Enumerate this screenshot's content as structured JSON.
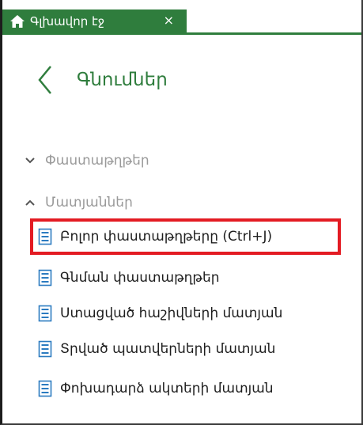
{
  "tab": {
    "title": "Գլխավոր էջ",
    "close_label": "×",
    "icon": "home-icon"
  },
  "header": {
    "title": "Գնումներ",
    "back_icon": "chevron-left-icon"
  },
  "sections": [
    {
      "label": "Փաստաթղթեր",
      "state": "collapsed",
      "icon": "chevron-down-icon"
    },
    {
      "label": "Մատյաններ",
      "state": "expanded",
      "icon": "chevron-up-icon"
    }
  ],
  "items": [
    {
      "label": "Բոլոր փաստաթղթերը (Ctrl+J)",
      "icon": "document-list-icon",
      "highlighted": true
    },
    {
      "label": "Գնման փաստաթղթեր",
      "icon": "document-list-icon"
    },
    {
      "label": "Ստացված հաշիվների մատյան",
      "icon": "document-list-icon"
    },
    {
      "label": "Տրված պատվերների մատյան",
      "icon": "document-list-icon"
    },
    {
      "label": "Փոխադարձ ակտերի մատյան",
      "icon": "document-list-icon"
    }
  ],
  "colors": {
    "accent": "#2f7d3d",
    "highlight_border": "#e31b23",
    "section_text": "#9a9a9a",
    "item_text": "#1e1e1e",
    "icon_blue": "#2b7bc0"
  }
}
